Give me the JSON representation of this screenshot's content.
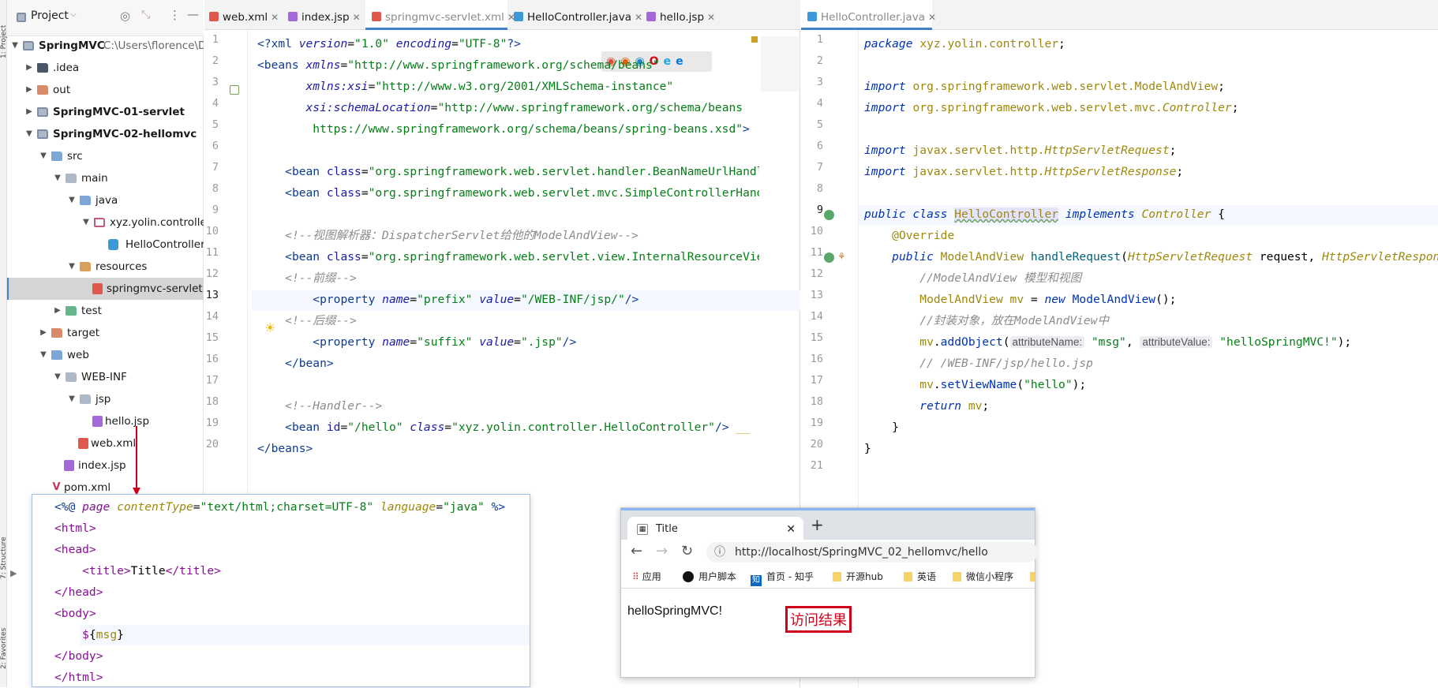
{
  "side_stripe": {
    "project_tab": "1: Project",
    "structure_tab": "7: Structure",
    "favorites_tab": "2: Favorites"
  },
  "project_panel": {
    "title": "Project",
    "tree": [
      {
        "label": "SpringMVC",
        "path": "C:\\Users\\florence\\De",
        "bold": true
      },
      {
        "label": ".idea"
      },
      {
        "label": "out"
      },
      {
        "label": "SpringMVC-01-servlet",
        "bold": true
      },
      {
        "label": "SpringMVC-02-hellomvc",
        "bold": true
      },
      {
        "label": "src"
      },
      {
        "label": "main"
      },
      {
        "label": "java"
      },
      {
        "label": "xyz.yolin.controller"
      },
      {
        "label": "HelloController"
      },
      {
        "label": "resources"
      },
      {
        "label": "springmvc-servlet.xml"
      },
      {
        "label": "test"
      },
      {
        "label": "target"
      },
      {
        "label": "web"
      },
      {
        "label": "WEB-INF"
      },
      {
        "label": "jsp"
      },
      {
        "label": "hello.jsp"
      },
      {
        "label": "web.xml"
      },
      {
        "label": "index.jsp"
      },
      {
        "label": "pom.xml"
      }
    ]
  },
  "left_editor": {
    "tabs": [
      {
        "label": "web.xml"
      },
      {
        "label": "index.jsp"
      },
      {
        "label": "springmvc-servlet.xml"
      },
      {
        "label": "HelloController.java"
      },
      {
        "label": "hello.jsp"
      }
    ],
    "line_numbers": [
      "1",
      "2",
      "3",
      "4",
      "5",
      "6",
      "7",
      "8",
      "9",
      "10",
      "11",
      "12",
      "13",
      "14",
      "15",
      "16",
      "17",
      "18",
      "19",
      "20"
    ]
  },
  "right_editor": {
    "tabs": [
      {
        "label": "HelloController.java"
      }
    ],
    "line_numbers": [
      "1",
      "2",
      "3",
      "4",
      "5",
      "6",
      "7",
      "8",
      "9",
      "10",
      "11",
      "12",
      "13",
      "14",
      "15",
      "16",
      "17",
      "18",
      "19",
      "20",
      "21"
    ]
  },
  "popup_jsp": {},
  "browser": {
    "tab_title": "Title",
    "new_tab": "+",
    "url": "http://localhost/SpringMVC_02_hellomvc/hello",
    "bookmarks": [
      "应用",
      "用户脚本",
      "首页 - 知乎",
      "开源hub",
      "英语",
      "微信小程序"
    ],
    "page_text": "helloSpringMVC!"
  },
  "annotation": {
    "label": "访问结果",
    "color": "#d0021b"
  }
}
